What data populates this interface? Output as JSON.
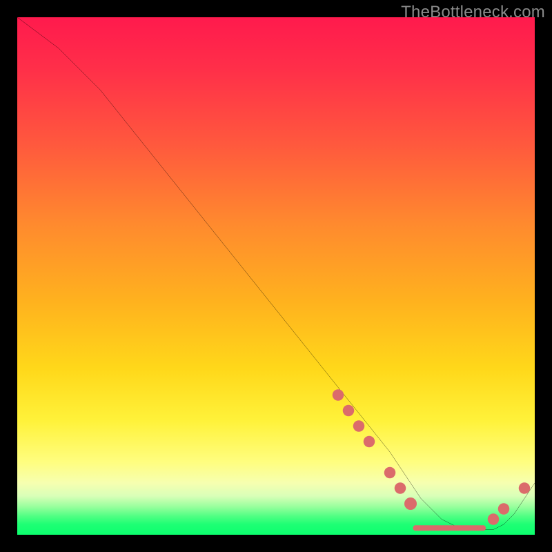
{
  "watermark": "TheBottleneck.com",
  "chart_data": {
    "type": "line",
    "title": "",
    "xlabel": "",
    "ylabel": "",
    "xlim": [
      0,
      100
    ],
    "ylim": [
      0,
      100
    ],
    "grid": false,
    "series": [
      {
        "name": "curve",
        "x": [
          0,
          4,
          8,
          12,
          16,
          20,
          24,
          28,
          32,
          36,
          40,
          44,
          48,
          52,
          56,
          60,
          64,
          68,
          72,
          74,
          76,
          78,
          80,
          82,
          84,
          86,
          88,
          90,
          92,
          94,
          96,
          98,
          100
        ],
        "y": [
          100,
          97,
          94,
          90,
          86,
          81,
          76,
          71,
          66,
          61,
          56,
          51,
          46,
          41,
          36,
          31,
          26,
          21,
          16,
          13,
          10,
          7,
          5,
          3,
          2,
          1,
          1,
          1,
          1,
          2,
          4,
          7,
          10
        ]
      }
    ],
    "markers": [
      {
        "x": 62,
        "y": 27,
        "r": 1.1
      },
      {
        "x": 64,
        "y": 24,
        "r": 1.1
      },
      {
        "x": 66,
        "y": 21,
        "r": 1.1
      },
      {
        "x": 68,
        "y": 18,
        "r": 1.1
      },
      {
        "x": 72,
        "y": 12,
        "r": 1.1
      },
      {
        "x": 74,
        "y": 9,
        "r": 1.1
      },
      {
        "x": 76,
        "y": 6,
        "r": 1.2
      },
      {
        "x": 92,
        "y": 3,
        "r": 1.1
      },
      {
        "x": 94,
        "y": 5,
        "r": 1.1
      },
      {
        "x": 98,
        "y": 9,
        "r": 1.1
      }
    ],
    "dense_dots": {
      "x_start": 77,
      "x_end": 90,
      "y": 1.3,
      "count": 28,
      "r": 0.55
    },
    "colors": {
      "curve": "#000000",
      "marker": "#db6b6b",
      "gradient_top": "#ff1a4d",
      "gradient_bottom": "#0cff6e"
    }
  }
}
